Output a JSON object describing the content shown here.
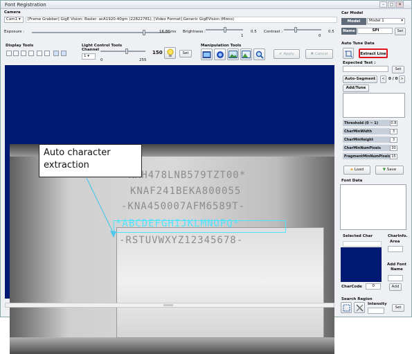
{
  "window": {
    "title": "Font Registration",
    "minimize": "–",
    "maximize": "□",
    "close": "✕"
  },
  "camera": {
    "section_label": "Camera",
    "cam_select": "Cam1",
    "device_info": "[Frame Grabber] GigE Vision: Basler: acA1920-40gm (22822781),   [Video Format] Generic GigEVision (Mono)",
    "exposure_label": "Exposure :",
    "exposure_value": "16.86",
    "exposure_unit": "ms",
    "brightness_label": "Brightness :",
    "brightness_min": "1",
    "brightness_value": "0.5",
    "contrast_label": "Contrast :",
    "contrast_min": "0",
    "contrast_value": "0.5",
    "exposure_level": 0.82,
    "brightness_level": 0.52,
    "contrast_level": 0.3
  },
  "car_model": {
    "section_label": "Car Model",
    "model_label": "Model",
    "model_value": "Model 1",
    "name_label": "Name",
    "name_value": "SPI",
    "set_button": "Set"
  },
  "display_tools": {
    "section_label": "Display Tools"
  },
  "light_control": {
    "section_label": "Light Control Tools",
    "channel_label": "Channel",
    "channel_value": "1",
    "min": "0",
    "max": "255",
    "value": "150",
    "set_button": "Set",
    "level": 0.59
  },
  "manipulation": {
    "section_label": "Manipulation Tools",
    "apply_button": "Apply",
    "cancel_button": "Cancel"
  },
  "auto_tune": {
    "section_label": "Auto Tune Data",
    "extract_button": "Extract Line",
    "expected_text_label": "Expected Text :",
    "set_button": "Set",
    "auto_segment_button": "Auto-Segment",
    "prev": "<",
    "counter": "0 / 0",
    "next": ">",
    "add_tune_button": "Add/Tune",
    "params": [
      {
        "label": "Threshold (0 ~ 1)",
        "value": "0.8"
      },
      {
        "label": "CharMinWidth",
        "value": "3"
      },
      {
        "label": "CharMinHeight",
        "value": "3"
      },
      {
        "label": "CharMinNumPixels",
        "value": "30"
      },
      {
        "label": "FragmentMinNumPixels",
        "value": "15"
      }
    ],
    "load_button": "Load",
    "save_button": "Save"
  },
  "font_data": {
    "section_label": "Font Data"
  },
  "selected_char": {
    "section_label": "Selected Char",
    "charinfo_label": "CharInfo.",
    "area_label": "Area",
    "add_font_name_label": "Add Font Name",
    "charcode_label": "CharCode",
    "charcode_value": "0",
    "add_button": "Add"
  },
  "search_region": {
    "section_label": "Search Region",
    "intensity_label": "Intensity",
    "set_button": "Set"
  },
  "image": {
    "line1": "*KMH478LNB579TZT00*",
    "line2": "KNAF241BEKA800055",
    "line3": "-KNA450007AFM6589T-",
    "line4": "*ABCDEFGHIJKLMNOPQ*",
    "line5": "-RSTUVWXYZ12345678-"
  },
  "annotation": {
    "text": "Auto character extraction"
  },
  "colors": {
    "image_bg": "#001a73",
    "highlight": "#e0141e",
    "accent_cyan": "#4fe3ff"
  }
}
